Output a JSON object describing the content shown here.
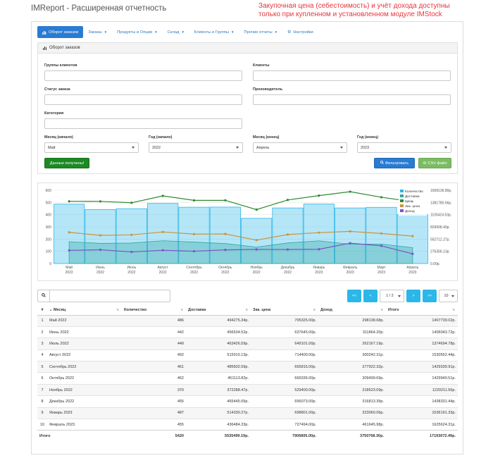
{
  "app_title": "IMReport - Расширенная отчетность",
  "notice": "Закупочная цена (себестоимость) и учёт дохода доступны только при купленном и установленном модуле IMStock",
  "nav": [
    {
      "label": "Оборот заказов",
      "icon": "bar-chart-icon",
      "active": true
    },
    {
      "label": "Заказы",
      "dropdown": true
    },
    {
      "label": "Продукты и Опции",
      "dropdown": true
    },
    {
      "label": "Склад",
      "dropdown": true
    },
    {
      "label": "Клиенты и Группы",
      "dropdown": true
    },
    {
      "label": "Прочие отчеты",
      "dropdown": true
    },
    {
      "label": "Настройки",
      "icon": "gears-icon"
    }
  ],
  "panel": {
    "title": "Оборот заказов",
    "filters": {
      "client_groups": {
        "label": "Группы клиентов",
        "value": ""
      },
      "clients": {
        "label": "Клиенты",
        "value": ""
      },
      "order_status": {
        "label": "Статус заказа",
        "value": ""
      },
      "manufacturer": {
        "label": "Производитель",
        "value": ""
      },
      "category": {
        "label": "Категория",
        "value": ""
      },
      "month_start": {
        "label": "Месяц (начало)",
        "value": "Май"
      },
      "year_start": {
        "label": "Год (начало)",
        "value": "2022"
      },
      "month_end": {
        "label": "Месяц (конец)",
        "value": "Апрель"
      },
      "year_end": {
        "label": "Год (конец)",
        "value": "2023"
      }
    },
    "status_button": "Данные получены!",
    "filter_button": "Фильтровать",
    "csv_button": "CSV файл"
  },
  "chart_data": {
    "type": "bar",
    "categories": [
      [
        "Май",
        "2022"
      ],
      [
        "Июнь",
        "2022"
      ],
      [
        "Июль",
        "2022"
      ],
      [
        "Август",
        "2022"
      ],
      [
        "Сентябрь",
        "2022"
      ],
      [
        "Октябрь",
        "2022"
      ],
      [
        "Ноябрь",
        "2022"
      ],
      [
        "Декабрь",
        "2022"
      ],
      [
        "Январь",
        "2023"
      ],
      [
        "Февраль",
        "2023"
      ],
      [
        "Март",
        "2023"
      ],
      [
        "Апрель",
        "2023"
      ]
    ],
    "y_left": {
      "min": 0,
      "max": 600,
      "ticks": [
        "0",
        "100",
        "200",
        "300",
        "400",
        "500",
        "600"
      ]
    },
    "y_right": {
      "min": 0,
      "max": 1658136.8,
      "ticks": [
        "0.00р.",
        "276356.13р.",
        "552712.27р.",
        "829068.40р.",
        "1105424.53р.",
        "1381780.66р.",
        "1658136.80р."
      ]
    },
    "series": [
      {
        "name": "Количество",
        "color": "#2bb7e9",
        "axis": "left",
        "kind": "bar",
        "values": [
          486,
          442,
          449,
          492,
          461,
          462,
          370,
          455,
          487,
          455,
          460,
          400
        ]
      },
      {
        "name": "Доставка",
        "color": "#30a7a0",
        "axis": "right",
        "kind": "area",
        "values": [
          494275,
          455535,
          463426,
          515910,
          485603,
          451113,
          372288,
          465445,
          514330,
          436484,
          440000,
          360000
        ]
      },
      {
        "name": "Цена",
        "color": "#2d8a2d",
        "axis": "right",
        "kind": "line",
        "values": [
          1407739,
          1406043,
          1374695,
          1530552,
          1429340,
          1429949,
          1220212,
          1438331,
          1536191,
          1625624,
          1500000,
          1400000
        ]
      },
      {
        "name": "Зак. цена",
        "color": "#c9953a",
        "axis": "right",
        "kind": "line",
        "values": [
          705325,
          637645,
          649101,
          714400,
          665815,
          669336,
          529400,
          656073,
          698801,
          727494,
          680000,
          620000
        ]
      },
      {
        "name": "Доход",
        "color": "#7b52c9",
        "axis": "right",
        "kind": "line",
        "values": [
          298138,
          311864,
          262167,
          300242,
          277922,
          309499,
          318523,
          316813,
          323060,
          461645,
          400000,
          220000
        ]
      }
    ],
    "legend": [
      "Количество",
      "Доставка",
      "Цена",
      "Зак. цена",
      "Доход"
    ],
    "legend_position": "top-right",
    "grid": true
  },
  "table_tools": {
    "search_placeholder": "",
    "first": "<<",
    "prev": "<",
    "page": "1 / 2",
    "next": ">",
    "last": ">>",
    "per_page": "10"
  },
  "table": {
    "columns": [
      "#",
      "Месяц",
      "Количество",
      "Доставка",
      "Зак. цена",
      "Доход",
      "Итого"
    ],
    "rows": [
      [
        "1",
        "Май 2022",
        "486",
        "494275.34р.",
        "705325.00р.",
        "298138.68р.",
        "1407739.02р."
      ],
      [
        "2",
        "Июнь 2022",
        "442",
        "456534.52р.",
        "637645.00р.",
        "311864.20р.",
        "1406043.72р."
      ],
      [
        "3",
        "Июль 2022",
        "449",
        "463426.59р.",
        "649101.00р.",
        "262167.19р.",
        "1374694.78р."
      ],
      [
        "4",
        "Август 2022",
        "492",
        "515910.13р.",
        "714400.00р.",
        "300242.31р.",
        "1530552.44р."
      ],
      [
        "5",
        "Сентябрь 2022",
        "461",
        "485602.59р.",
        "665815.00р.",
        "277922.32р.",
        "1429339.91р."
      ],
      [
        "6",
        "Октябрь 2022",
        "462",
        "451113.82р.",
        "669336.00р.",
        "309499.69р.",
        "1429949.51р."
      ],
      [
        "7",
        "Ноябрь 2022",
        "370",
        "372288.47р.",
        "529400.00р.",
        "318523.09р.",
        "1220211.56р."
      ],
      [
        "8",
        "Декабрь 2022",
        "455",
        "465445.05р.",
        "656073.00р.",
        "316813.39р.",
        "1438331.44р."
      ],
      [
        "9",
        "Январь 2023",
        "487",
        "514330.27р.",
        "698801.00р.",
        "323060.06р.",
        "1536191.33р."
      ],
      [
        "10",
        "Февраль 2023",
        "455",
        "436484.33р.",
        "727494.00р.",
        "461645.98р.",
        "1625624.31р."
      ]
    ],
    "total": [
      "Итого",
      "5420",
      "5535499.19р.",
      "7906805.00р.",
      "3750768.30р.",
      "17193072.49р."
    ]
  }
}
